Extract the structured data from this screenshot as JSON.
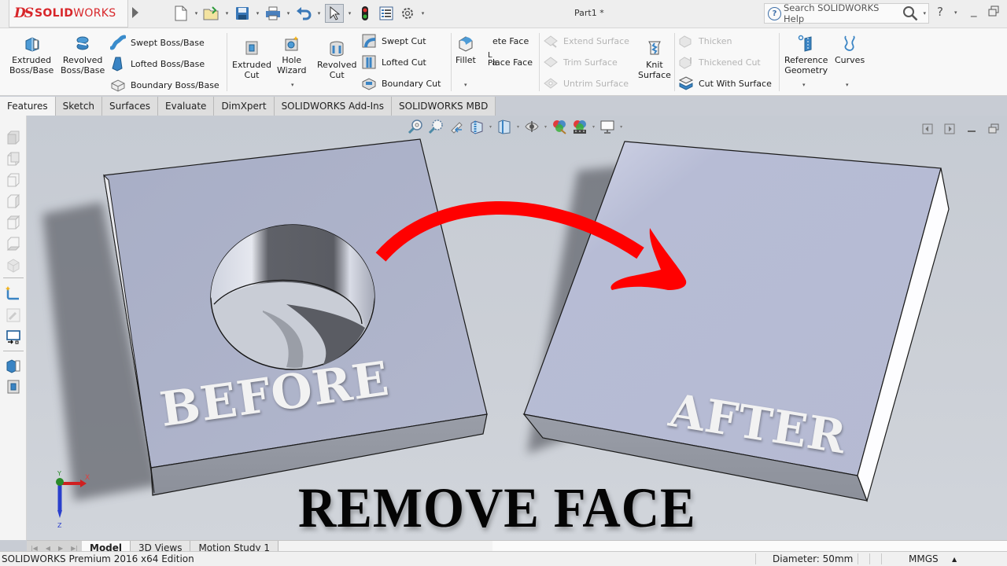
{
  "app": {
    "logo_mark": "DS",
    "logo_bold": "SOLID",
    "logo_light": "WORKS",
    "window_title": "Part1 *",
    "brand_color": "#d8262a"
  },
  "quick_access": [
    {
      "name": "new-document",
      "icon": "new-doc-icon"
    },
    {
      "name": "open",
      "icon": "open-folder-icon"
    },
    {
      "name": "save",
      "icon": "save-icon"
    },
    {
      "name": "print",
      "icon": "print-icon"
    },
    {
      "name": "undo",
      "icon": "undo-icon"
    },
    {
      "name": "select",
      "icon": "cursor-icon"
    },
    {
      "name": "rebuild",
      "icon": "traffic-light-icon"
    },
    {
      "name": "file-properties",
      "icon": "properties-icon"
    },
    {
      "name": "options",
      "icon": "gear-icon"
    }
  ],
  "help": {
    "search_placeholder": "Search SOLIDWORKS Help",
    "help_label": "?"
  },
  "ribbon": {
    "extruded_boss": "Extruded\nBoss/Base",
    "revolved_boss": "Revolved\nBoss/Base",
    "swept_boss": "Swept Boss/Base",
    "lofted_boss": "Lofted Boss/Base",
    "boundary_boss": "Boundary Boss/Base",
    "extruded_cut": "Extruded\nCut",
    "hole_wizard": "Hole\nWizard",
    "revolved_cut": "Revolved\nCut",
    "swept_cut": "Swept Cut",
    "lofted_cut": "Lofted Cut",
    "boundary_cut": "Boundary Cut",
    "fillet": "Fillet",
    "delete_face": "ete Face",
    "replace_face": "lace Face",
    "partial_label_1": "L",
    "partial_label_2": "Pa",
    "extend_surface": "Extend Surface",
    "trim_surface": "Trim Surface",
    "untrim_surface": "Untrim Surface",
    "knit_surface": "Knit\nSurface",
    "thicken": "Thicken",
    "thickened_cut": "Thickened Cut",
    "cut_with_surface": "Cut With Surface",
    "reference_geometry": "Reference\nGeometry",
    "curves": "Curves"
  },
  "tabs": [
    {
      "label": "Features",
      "active": true
    },
    {
      "label": "Sketch",
      "active": false
    },
    {
      "label": "Surfaces",
      "active": false
    },
    {
      "label": "Evaluate",
      "active": false
    },
    {
      "label": "DimXpert",
      "active": false
    },
    {
      "label": "SOLIDWORKS Add-Ins",
      "active": false
    },
    {
      "label": "SOLIDWORKS MBD",
      "active": false
    }
  ],
  "viewport": {
    "before_label": "BEFORE",
    "after_label": "AFTER",
    "headline": "REMOVE FACE",
    "arrow_color": "#ff0000",
    "part_color": "#b0b6cf",
    "triad": {
      "x": "X",
      "y": "Y",
      "z": "Z"
    }
  },
  "bottom_tabs": [
    {
      "label": "Model",
      "active": true
    },
    {
      "label": "3D Views",
      "active": false
    },
    {
      "label": "Motion Study 1",
      "active": false
    }
  ],
  "status": {
    "edition": "SOLIDWORKS Premium 2016 x64 Edition",
    "measure": "Diameter: 50mm",
    "units": "MMGS"
  }
}
